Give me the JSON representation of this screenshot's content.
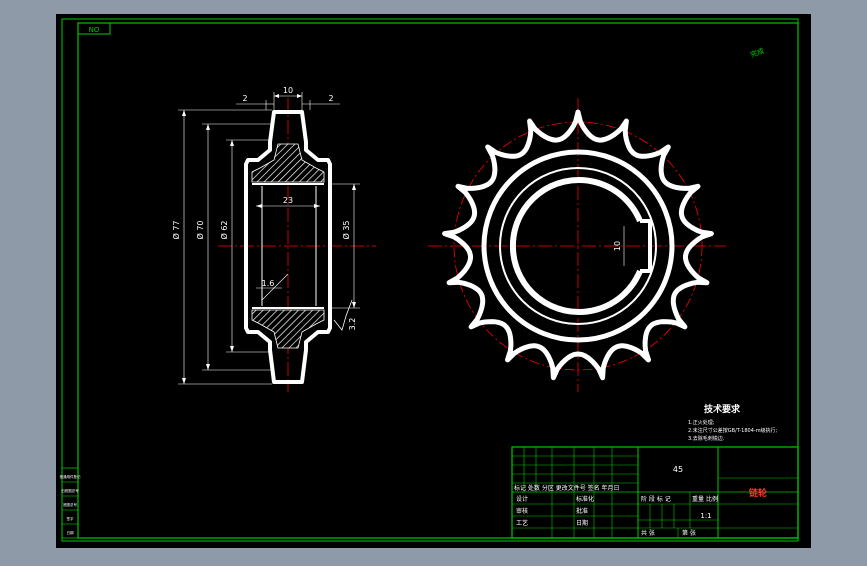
{
  "drawing": {
    "zone_label": "NO",
    "corner_mark": "完成",
    "material": "45",
    "part_name": "链轮",
    "scale": "1:1"
  },
  "dimensions": {
    "flange_left": "2",
    "hub_width": "10",
    "flange_right": "2",
    "bore_length": "23",
    "dia_77": "Ø 77",
    "dia_70": "Ø 70",
    "dia_62": "Ø 62",
    "dia_35": "Ø 35",
    "chamfer": "1.6",
    "roughness": "3.2",
    "keyway": "10"
  },
  "tech_notes": {
    "title": "技术要求",
    "items": [
      "1.正火处理;",
      "2.未注尺寸公差按GB/T-1804-m级执行;",
      "3.去除毛刺锐边."
    ]
  },
  "title_block": {
    "revision_header": "标记  处数  分区  更改文件号  签名  年月日",
    "rows": [
      {
        "role": "设计",
        "role2": "标准化"
      },
      {
        "role": "审核",
        "role2": "批准"
      },
      {
        "role": "工艺",
        "role2": "日期"
      }
    ],
    "stage_header": "阶  段  标  记",
    "weight_label": "重量",
    "scale_label": "比例",
    "sheets_total": "共   张",
    "sheet_num": "第   张"
  },
  "side_stamp": [
    "借通用件登记",
    "旧底图总号",
    "底图总号",
    "签字",
    "日期"
  ],
  "colors": {
    "frame": "#00c800",
    "outline": "#ffffff",
    "center": "#ff0000",
    "dim": "#ffffff",
    "name_text": "#ff3030"
  }
}
